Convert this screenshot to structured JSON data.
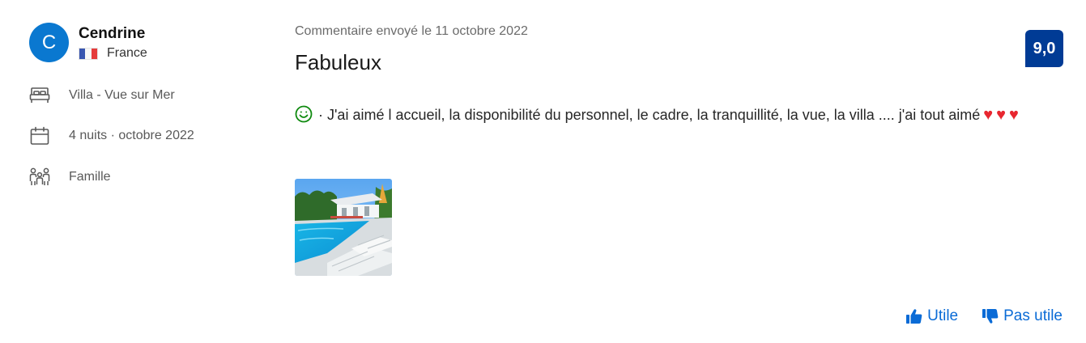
{
  "reviewer": {
    "initial": "C",
    "name": "Cendrine",
    "country": "France",
    "flag": "flag-france"
  },
  "stay": {
    "room": "Villa - Vue sur Mer",
    "duration": "4 nuits ·  octobre 2022",
    "traveler_type": "Famille"
  },
  "review": {
    "date": "Commentaire envoyé le 11 octobre 2022",
    "title": "Fabuleux",
    "body": " · J'ai aimé l accueil, la disponibilité du personnel, le cadre, la tranquillité, la vue, la villa .... j'ai tout aimé",
    "hearts": "♥♥♥",
    "score": "9,0"
  },
  "actions": {
    "helpful": "Utile",
    "not_helpful": "Pas utile"
  },
  "colors": {
    "avatar": "#0a78d0",
    "score_badge": "#003b95",
    "link": "#0a6bd6",
    "smiley": "#0f8a0f",
    "heart": "#e8262f"
  },
  "icons": {
    "room": "bed-icon",
    "nights": "calendar-icon",
    "group": "family-icon",
    "sentiment": "smiley-icon",
    "helpful": "thumbs-up-icon",
    "not_helpful": "thumbs-down-icon"
  }
}
